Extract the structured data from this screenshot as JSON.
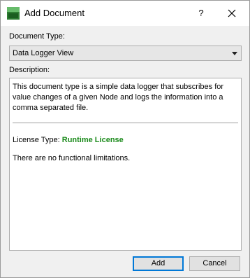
{
  "window": {
    "title": "Add Document",
    "help_glyph": "?",
    "icon": "app-icon"
  },
  "form": {
    "doc_type_label": "Document Type:",
    "doc_type_value": "Data Logger View",
    "description_label": "Description:",
    "description_text": "This document type is a simple data logger that subscribes for value changes of a given Node and logs the information into a comma separated file.",
    "license_label": "License Type:",
    "license_value": "Runtime License",
    "limitations_text": "There are no functional limitations."
  },
  "buttons": {
    "add": "Add",
    "cancel": "Cancel"
  },
  "colors": {
    "license_green": "#1a8a1a",
    "accent": "#0078d7"
  }
}
